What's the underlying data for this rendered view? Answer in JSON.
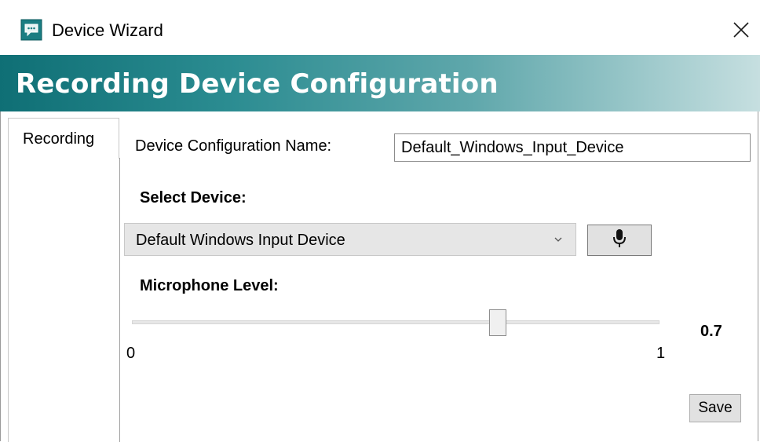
{
  "window": {
    "title": "Device Wizard",
    "icon": "chat-bubble-icon",
    "close_icon": "close-icon"
  },
  "banner": {
    "title": "Recording Device Configuration",
    "gradient_colors": [
      "#0f6f75",
      "#5fa7ab",
      "#c6dfe0"
    ]
  },
  "tabs": [
    {
      "label": "Recording",
      "selected": true
    }
  ],
  "form": {
    "config_name_label": "Device Configuration Name:",
    "config_name_value": "Default_Windows_Input_Device",
    "select_device_label": "Select Device:",
    "selected_device": "Default Windows Input Device",
    "mic_button_icon": "microphone-icon",
    "mic_level_label": "Microphone Level:",
    "mic_level": {
      "min": "0",
      "max": "1",
      "value": 0.7,
      "value_display": "0.7"
    },
    "save_label": "Save"
  }
}
